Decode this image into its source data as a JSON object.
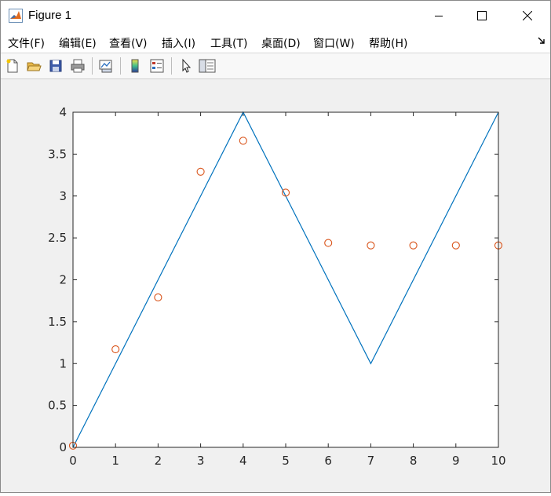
{
  "window": {
    "title": "Figure 1"
  },
  "menu": {
    "items": [
      {
        "label": "文件(F)"
      },
      {
        "label": "编辑(E)"
      },
      {
        "label": "查看(V)"
      },
      {
        "label": "插入(I)"
      },
      {
        "label": "工具(T)"
      },
      {
        "label": "桌面(D)"
      },
      {
        "label": "窗口(W)"
      },
      {
        "label": "帮助(H)"
      }
    ]
  },
  "toolbar": {
    "buttons": [
      "new-figure-icon",
      "open-file-icon",
      "save-icon",
      "print-icon",
      "link-plot-icon",
      "insert-colorbar-icon",
      "insert-legend-icon",
      "edit-plot-arrow-icon",
      "property-inspector-icon"
    ]
  },
  "colors": {
    "line": "#0072bd",
    "markers": "#d95319",
    "axes": "#262626"
  },
  "chart_data": {
    "type": "line",
    "xlim": [
      0,
      10
    ],
    "ylim": [
      0,
      4
    ],
    "x_ticks": [
      "0",
      "1",
      "2",
      "3",
      "4",
      "5",
      "6",
      "7",
      "8",
      "9",
      "10"
    ],
    "y_ticks": [
      "0",
      "0.5",
      "1",
      "1.5",
      "2",
      "2.5",
      "3",
      "3.5",
      "4"
    ],
    "grid": false,
    "series": [
      {
        "style": "line",
        "color": "#0072bd",
        "x": [
          0,
          4,
          7,
          10
        ],
        "y": [
          0,
          4,
          1,
          4
        ]
      },
      {
        "style": "circle-markers",
        "color": "#d95319",
        "x": [
          0,
          1,
          2,
          3,
          4,
          5,
          6,
          7,
          8,
          9,
          10
        ],
        "y": [
          0.02,
          1.17,
          1.79,
          3.29,
          3.66,
          3.04,
          2.44,
          2.41,
          2.41,
          2.41,
          2.41
        ]
      }
    ]
  }
}
